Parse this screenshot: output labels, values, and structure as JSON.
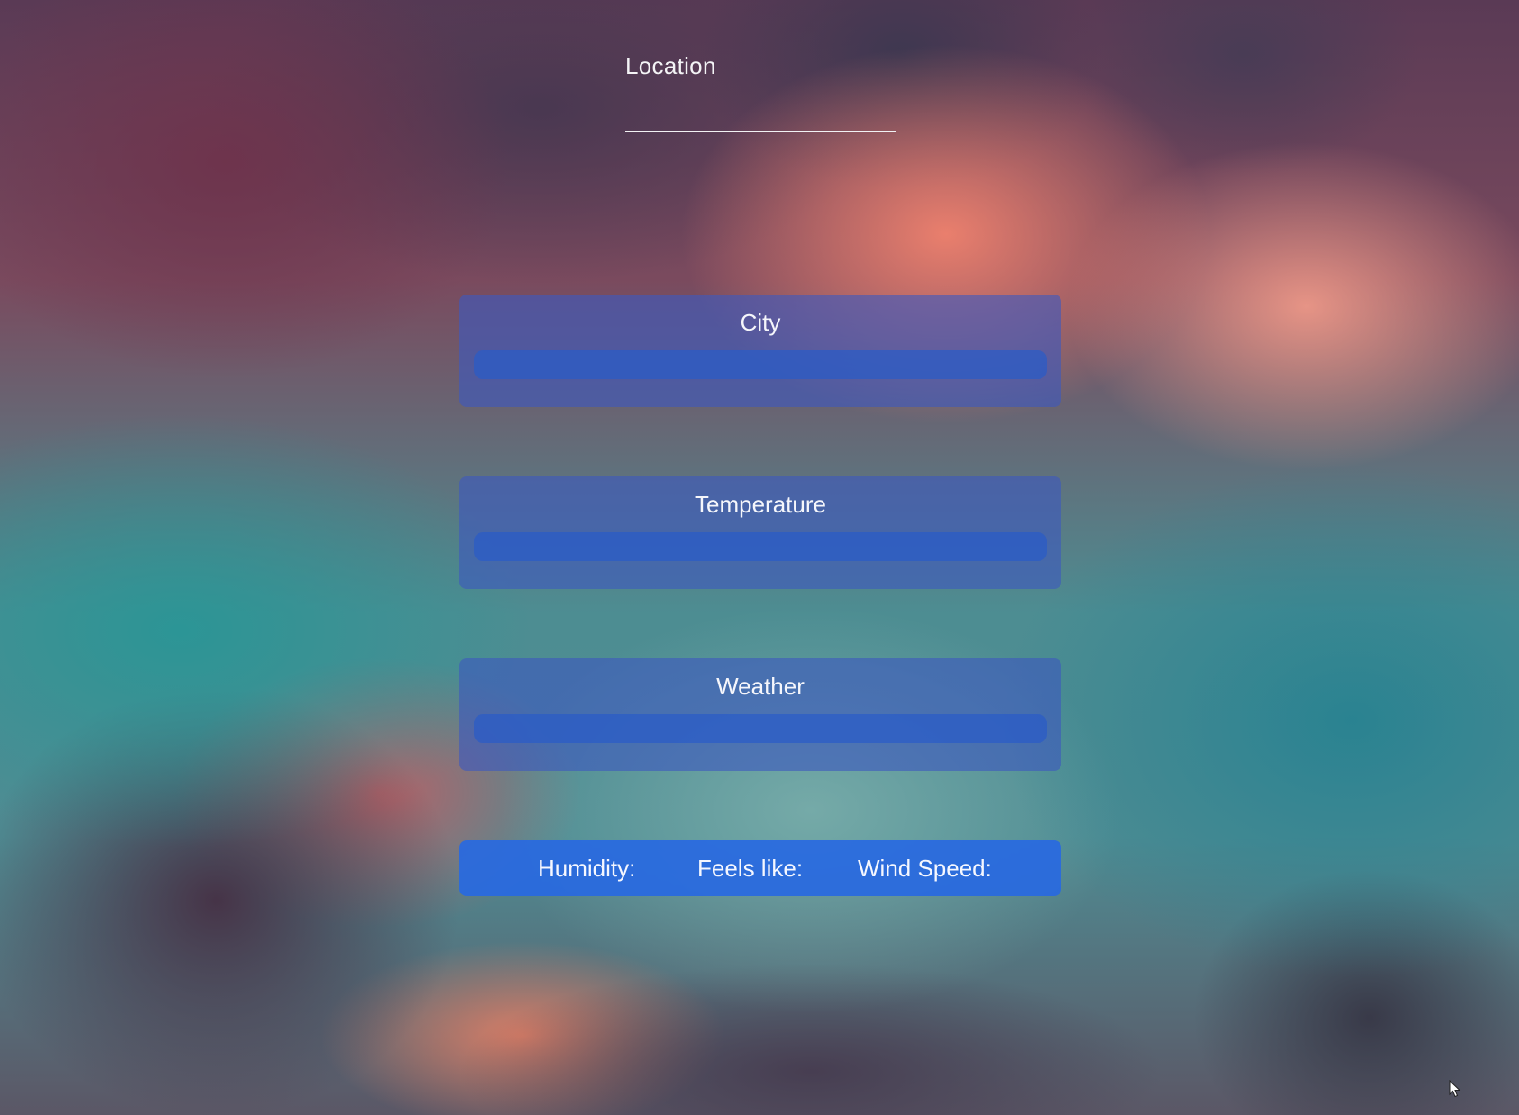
{
  "location": {
    "label": "Location",
    "input_value": "",
    "input_placeholder": ""
  },
  "panels": {
    "city": {
      "title": "City",
      "value": ""
    },
    "temperature": {
      "title": "Temperature",
      "value": ""
    },
    "weather": {
      "title": "Weather",
      "value": ""
    }
  },
  "stats": {
    "humidity_label": "Humidity:",
    "feels_like_label": "Feels like:",
    "wind_speed_label": "Wind Speed:"
  },
  "colors": {
    "panel_background": "#3e58be",
    "panel_bar": "#2a5cc8",
    "stats_background": "#2869e1",
    "text": "#ffffff"
  },
  "icons": {
    "cursor": "mouse-cursor-icon"
  }
}
